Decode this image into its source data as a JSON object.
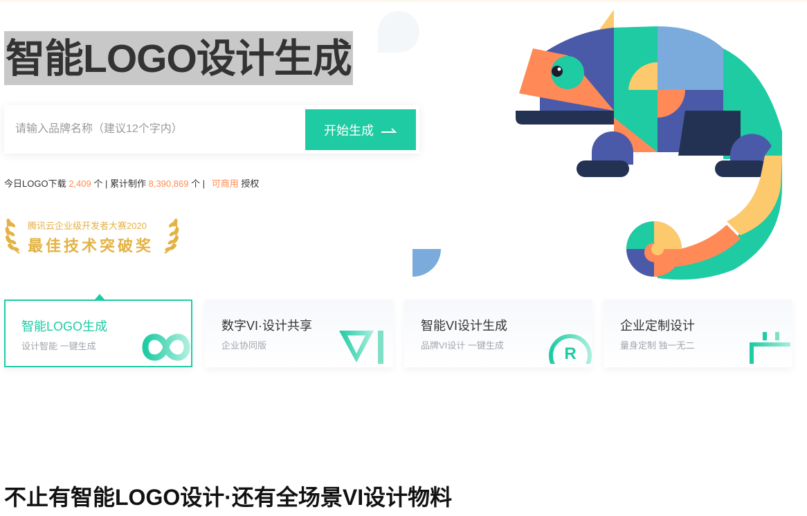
{
  "hero": {
    "title": "智能LOGO设计生成"
  },
  "search": {
    "placeholder": "请输入品牌名称（建议12个字内）",
    "button_label": "开始生成"
  },
  "stats": {
    "download_label": "今日LOGO下载",
    "download_count": "2,409",
    "unit1": "个 | 累计制作",
    "total_count": "8,390,869",
    "unit2": "个 |",
    "commercial_link": "可商用",
    "auth_label": "授权"
  },
  "award": {
    "line1": "腾讯云企业级开发者大赛2020",
    "line2": "最佳技术突破奖"
  },
  "cards": [
    {
      "title": "智能LOGO生成",
      "subtitle": "设计智能 一键生成",
      "icon": "infinity-icon",
      "active": true
    },
    {
      "title": "数字VI·设计共享",
      "subtitle": "企业协同版",
      "icon": "vi-letters-icon",
      "active": false
    },
    {
      "title": "智能VI设计生成",
      "subtitle": "品牌VI设计 一键生成",
      "icon": "registered-icon",
      "active": false
    },
    {
      "title": "企业定制设计",
      "subtitle": "量身定制 独一无二",
      "icon": "building-icon",
      "active": false
    }
  ],
  "section": {
    "title": "不止有智能LOGO设计·还有全场景VI设计物料"
  },
  "colors": {
    "accent": "#1ecba3",
    "highlight": "#ff8a50",
    "gold": "#e4b243",
    "navy": "#233253",
    "indigo": "#4a5aa8",
    "yellow": "#fdc96d",
    "blue": "#7aabdc",
    "coral": "#ff8a58"
  }
}
